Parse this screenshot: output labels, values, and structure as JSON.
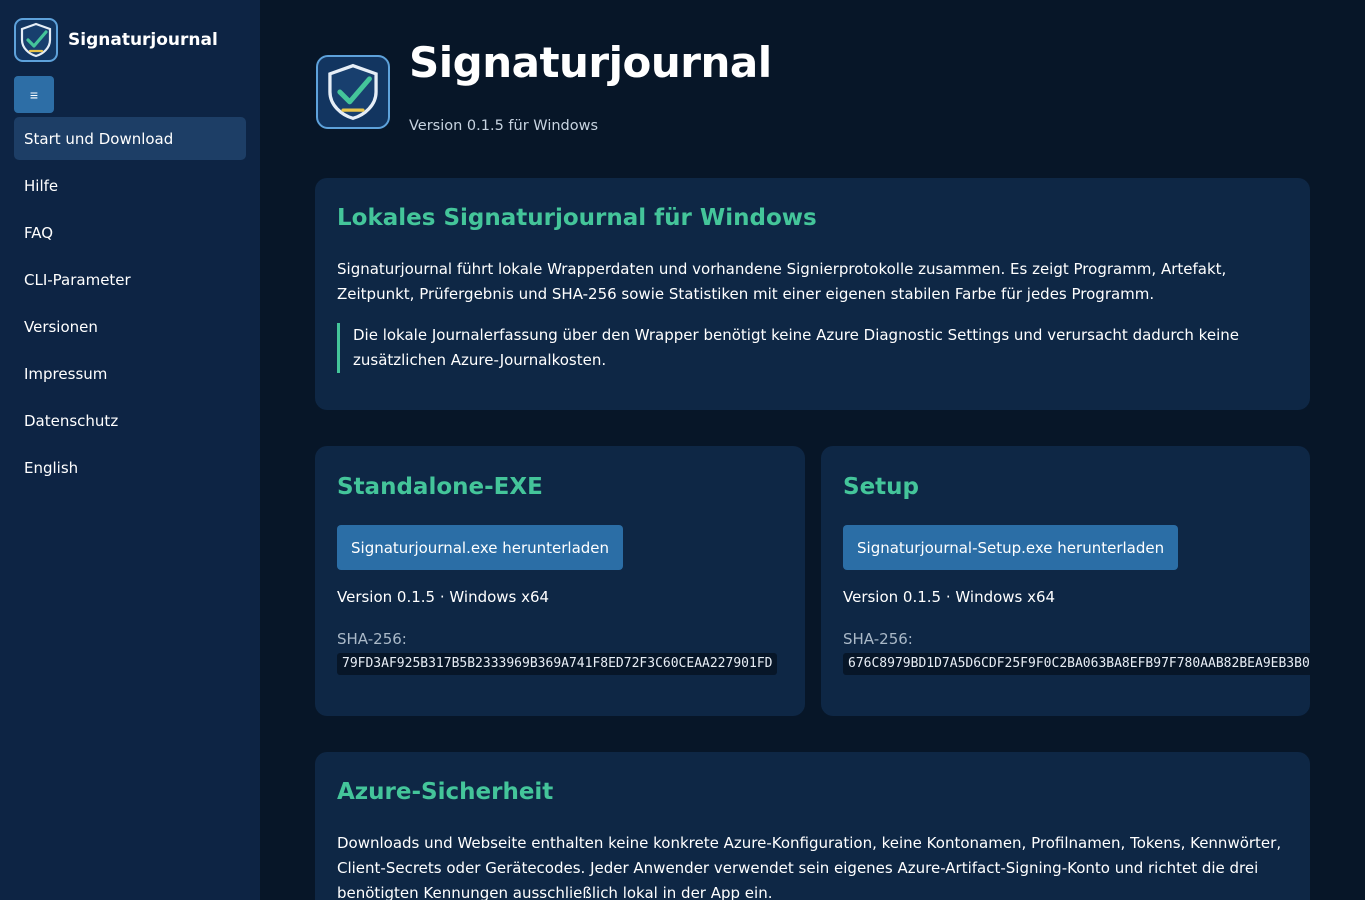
{
  "brand": {
    "name": "Signaturjournal",
    "logo_icon": "shield-check-icon"
  },
  "menu_toggle": {
    "label": "≡"
  },
  "nav": {
    "items": [
      {
        "label": "Start und Download",
        "active": true
      },
      {
        "label": "Hilfe"
      },
      {
        "label": "FAQ"
      },
      {
        "label": "CLI-Parameter"
      },
      {
        "label": "Versionen"
      },
      {
        "label": "Impressum"
      },
      {
        "label": "Datenschutz"
      },
      {
        "label": "English"
      }
    ]
  },
  "hero": {
    "title": "Signaturjournal",
    "version": "Version 0.1.5 für Windows"
  },
  "intro": {
    "heading": "Lokales Signaturjournal für Windows",
    "text": "Signaturjournal führt lokale Wrapperdaten und vorhandene Signierprotokolle zusammen. Es zeigt Programm, Artefakt, Zeitpunkt, Prüfergebnis und SHA-256 sowie Statistiken mit einer eigenen stabilen Farbe für jedes Programm.",
    "note": "Die lokale Journalerfassung über den Wrapper benötigt keine Azure Diagnostic Settings und verursacht dadurch keine zusätzlichen Azure-Journalkosten."
  },
  "downloads": {
    "standalone": {
      "heading": "Standalone-EXE",
      "button": "Signaturjournal.exe herunterladen",
      "meta": "Version 0.1.5 · Windows x64",
      "sha_label": "SHA-256:",
      "sha": "79FD3AF925B317B5B2333969B369A741F8ED72F3C60CEAA227901FD"
    },
    "setup": {
      "heading": "Setup",
      "button": "Signaturjournal-Setup.exe herunterladen",
      "meta": "Version 0.1.5 · Windows x64",
      "sha_label": "SHA-256:",
      "sha": "676C8979BD1D7A5D6CDF25F9F0C2BA063BA8EFB97F780AAB82BEA9EB3B0"
    }
  },
  "security": {
    "heading": "Azure-Sicherheit",
    "text": "Downloads und Webseite enthalten keine konkrete Azure-Konfiguration, keine Kontonamen, Profilnamen, Tokens, Kennwörter, Client-Secrets oder Gerätecodes. Jeder Anwender verwendet sein eigenes Azure-Artifact-Signing-Konto und richtet die drei benötigten Kennungen ausschließlich lokal in der App ein."
  },
  "colors": {
    "background": "#071628",
    "sidebar": "#0d2444",
    "card": "#0e2745",
    "accent_green": "#44c59a",
    "button_blue": "#2b6ea6"
  }
}
